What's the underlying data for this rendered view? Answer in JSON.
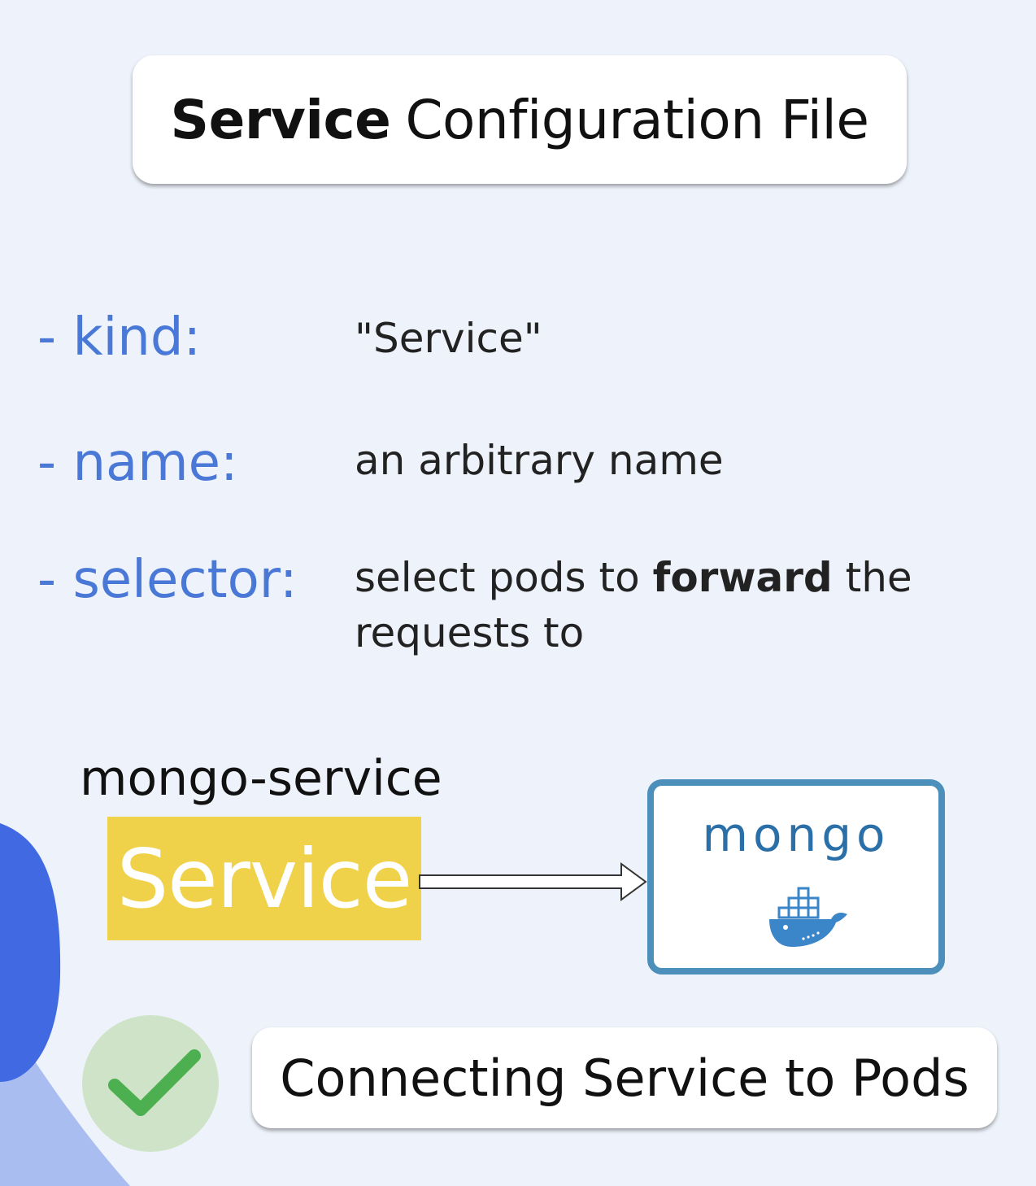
{
  "title": {
    "bold": "Service",
    "rest": "Configuration File"
  },
  "fields": [
    {
      "key": "- kind:",
      "value": "\"Service\""
    },
    {
      "key": "- name:",
      "value": "an arbitrary name"
    },
    {
      "key": "- selector:",
      "value_pre": "select pods to ",
      "value_bold": "forward",
      "value_post": " the",
      "value_line2": "requests to"
    }
  ],
  "diagram": {
    "service_name": "mongo-service",
    "service_box_label": "Service",
    "pod_label": "mongo",
    "pod_icon": "docker-whale-icon",
    "colors": {
      "service": "#f0d14a",
      "pod_border": "#4c8fba",
      "check": "#4caf50"
    }
  },
  "footer": {
    "label": "Connecting Service to Pods",
    "icon": "checkmark-icon"
  }
}
